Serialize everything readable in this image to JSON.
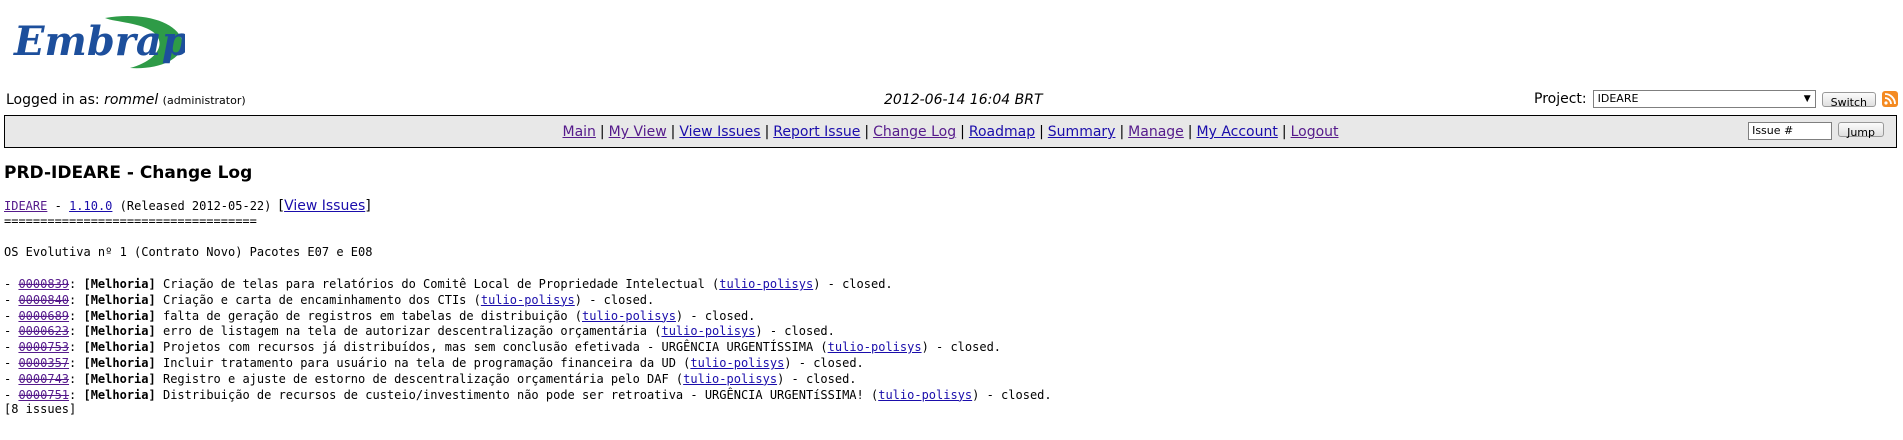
{
  "brand": {
    "logo_text": "Embrapa",
    "logo_color": "#1d4f9c",
    "logo_green": "#2e9b47"
  },
  "header": {
    "logged_prefix": "Logged in as:",
    "username": "rommel",
    "role": "(administrator)",
    "datetime": "2012-06-14 16:04 BRT",
    "project_label": "Project:",
    "project_selected": "IDEARE",
    "switch_label": "Switch"
  },
  "menu": {
    "items": [
      "Main",
      "My View",
      "View Issues",
      "Report Issue",
      "Change Log",
      "Roadmap",
      "Summary",
      "Manage",
      "My Account",
      "Logout"
    ],
    "separator": "|",
    "issue_placeholder": "Issue #",
    "jump_label": "Jump"
  },
  "page": {
    "title": "PRD-IDEARE - Change Log",
    "project_link": "IDEARE",
    "dash": "-",
    "version_link": "1.10.0",
    "released": "(Released 2012-05-22)",
    "view_open": "[",
    "view_issues": "View Issues",
    "view_close": "]",
    "rule": "===================================",
    "description": "OS Evolutiva nº 1 (Contrato Novo) Pacotes E07 e E08",
    "issues": [
      {
        "id": "0000839",
        "category": "[Melhoria]",
        "summary": "Criação de telas para relatórios do Comitê Local de Propriedade Intelectual (",
        "handler": "tulio-polisys",
        "status": ") - closed."
      },
      {
        "id": "0000840",
        "category": "[Melhoria]",
        "summary": "Criação e carta de encaminhamento dos CTIs (",
        "handler": "tulio-polisys",
        "status": ") - closed."
      },
      {
        "id": "0000689",
        "category": "[Melhoria]",
        "summary": "falta de geração de registros em tabelas de distribuição (",
        "handler": "tulio-polisys",
        "status": ") - closed."
      },
      {
        "id": "0000623",
        "category": "[Melhoria]",
        "summary": "erro de listagem na tela de autorizar descentralização orçamentária (",
        "handler": "tulio-polisys",
        "status": ") - closed."
      },
      {
        "id": "0000753",
        "category": "[Melhoria]",
        "summary": "Projetos com recursos já distribuídos, mas sem conclusão efetivada - URGÊNCIA URGENTÍSSIMA (",
        "handler": "tulio-polisys",
        "status": ") - closed."
      },
      {
        "id": "0000357",
        "category": "[Melhoria]",
        "summary": "Incluir tratamento para usuário na tela de programação financeira da UD (",
        "handler": "tulio-polisys",
        "status": ") - closed."
      },
      {
        "id": "0000743",
        "category": "[Melhoria]",
        "summary": "Registro e ajuste de estorno de descentralização orçamentária pelo DAF (",
        "handler": "tulio-polisys",
        "status": ") - closed."
      },
      {
        "id": "0000751",
        "category": "[Melhoria]",
        "summary": "Distribuição de recursos de custeio/investimento não pode ser retroativa - URGÊNCIA URGENTíSSIMA! (",
        "handler": "tulio-polisys",
        "status": ") - closed."
      }
    ],
    "issue_count": "[8 issues]"
  }
}
